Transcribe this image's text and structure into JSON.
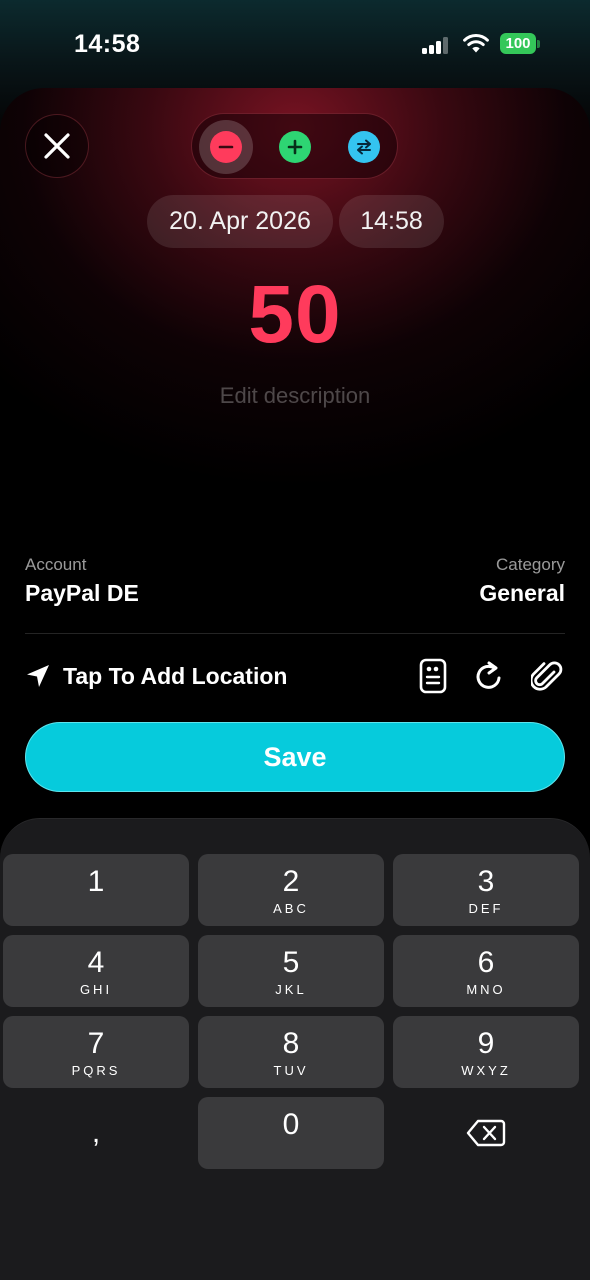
{
  "status_bar": {
    "time": "14:58",
    "battery": "100",
    "battery_color": "#34c759"
  },
  "header": {
    "close_icon": "close-icon",
    "type_switch": [
      {
        "icon": "minus-icon",
        "color": "#ff3b5c",
        "selected": true
      },
      {
        "icon": "plus-icon",
        "color": "#2ed573",
        "selected": false
      },
      {
        "icon": "transfer-icon",
        "color": "#34c4f0",
        "selected": false
      }
    ],
    "date": "20. Apr 2026",
    "time": "14:58"
  },
  "amount": {
    "value": "50",
    "color": "#ff3b5c"
  },
  "description": {
    "placeholder": "Edit description"
  },
  "account": {
    "label": "Account",
    "value": "PayPal DE"
  },
  "category": {
    "label": "Category",
    "value": "General"
  },
  "location": {
    "label": "Tap To Add Location",
    "icon": "location-arrow-icon"
  },
  "tools": [
    "receipt-icon",
    "repeat-icon",
    "paperclip-icon"
  ],
  "save": {
    "label": "Save",
    "color": "#06cbdc"
  },
  "keypad": {
    "keys": [
      {
        "digit": "1",
        "letters": ""
      },
      {
        "digit": "2",
        "letters": "ABC"
      },
      {
        "digit": "3",
        "letters": "DEF"
      },
      {
        "digit": "4",
        "letters": "GHI"
      },
      {
        "digit": "5",
        "letters": "JKL"
      },
      {
        "digit": "6",
        "letters": "MNO"
      },
      {
        "digit": "7",
        "letters": "PQRS"
      },
      {
        "digit": "8",
        "letters": "TUV"
      },
      {
        "digit": "9",
        "letters": "WXYZ"
      },
      {
        "digit": "0",
        "letters": ""
      }
    ],
    "decimal": ",",
    "delete_icon": "backspace-icon"
  }
}
